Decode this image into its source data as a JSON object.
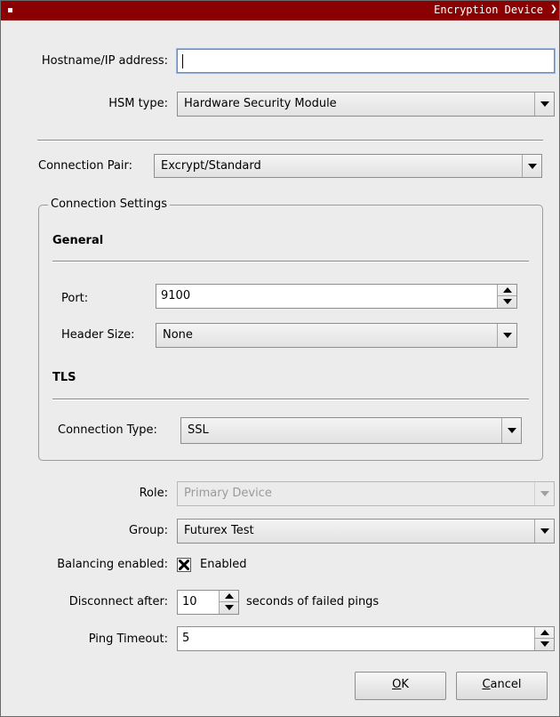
{
  "window": {
    "title": "Encryption Device"
  },
  "hostname": {
    "label": "Hostname/IP address:",
    "value": ""
  },
  "hsm_type": {
    "label": "HSM type:",
    "value": "Hardware Security Module"
  },
  "connection_pair": {
    "label": "Connection Pair:",
    "value": "Excrypt/Standard"
  },
  "connection_settings": {
    "title": "Connection Settings",
    "general": {
      "heading": "General",
      "port": {
        "label": "Port:",
        "value": "9100"
      },
      "header_size": {
        "label": "Header Size:",
        "value": "None"
      }
    },
    "tls": {
      "heading": "TLS",
      "connection_type": {
        "label": "Connection Type:",
        "value": "SSL"
      }
    }
  },
  "role": {
    "label": "Role:",
    "value": "Primary Device",
    "disabled": true
  },
  "group": {
    "label": "Group:",
    "value": "Futurex Test"
  },
  "balancing": {
    "label": "Balancing enabled:",
    "checkbox_label": "Enabled",
    "checked": true
  },
  "disconnect": {
    "label": "Disconnect after:",
    "value": "10",
    "suffix": "seconds of failed pings"
  },
  "ping_timeout": {
    "label": "Ping Timeout:",
    "value": "5"
  },
  "buttons": {
    "ok": {
      "mnemonic": "O",
      "rest": "K"
    },
    "cancel": {
      "mnemonic": "C",
      "rest": "ancel"
    }
  }
}
